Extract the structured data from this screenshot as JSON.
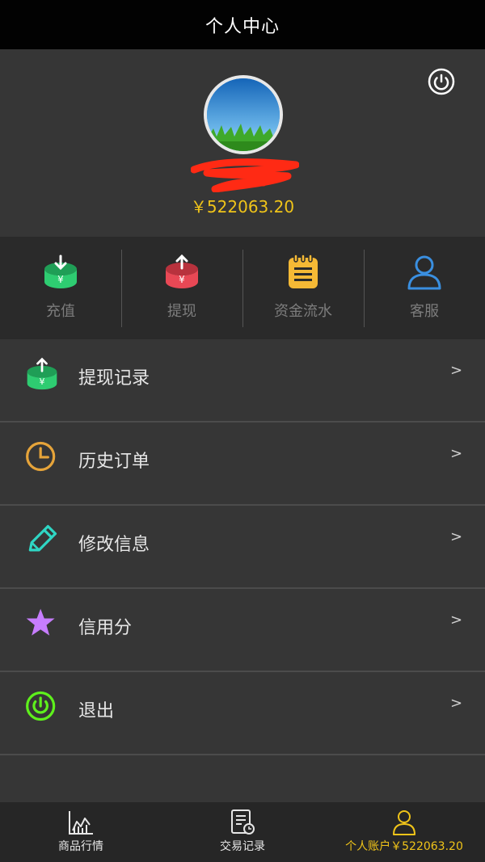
{
  "header": {
    "title": "个人中心"
  },
  "profile": {
    "balance": "￥522063.20",
    "power_icon": "power-icon",
    "avatar_icon": "avatar-image"
  },
  "quick_actions": [
    {
      "label": "充值",
      "icon": "recharge-icon",
      "color": "#2ecc71"
    },
    {
      "label": "提现",
      "icon": "withdraw-icon",
      "color": "#e84855"
    },
    {
      "label": "资金流水",
      "icon": "ledger-icon",
      "color": "#f5b935"
    },
    {
      "label": "客服",
      "icon": "user-icon",
      "color": "#3a8fe0"
    }
  ],
  "menu": [
    {
      "label": "提现记录",
      "icon": "withdraw-record-icon",
      "arrow": ">"
    },
    {
      "label": "历史订单",
      "icon": "clock-icon",
      "arrow": ">"
    },
    {
      "label": "修改信息",
      "icon": "pencil-icon",
      "arrow": ">"
    },
    {
      "label": "信用分",
      "icon": "star-icon",
      "arrow": ">"
    },
    {
      "label": "退出",
      "icon": "logout-icon",
      "arrow": ">"
    }
  ],
  "tabbar": [
    {
      "label": "商品行情",
      "icon": "chart-icon"
    },
    {
      "label": "交易记录",
      "icon": "records-icon"
    },
    {
      "label": "个人账户￥522063.20",
      "icon": "person-icon",
      "active": true
    }
  ],
  "colors": {
    "accent": "#f0c419",
    "background": "#363636",
    "topbar": "#020202"
  }
}
